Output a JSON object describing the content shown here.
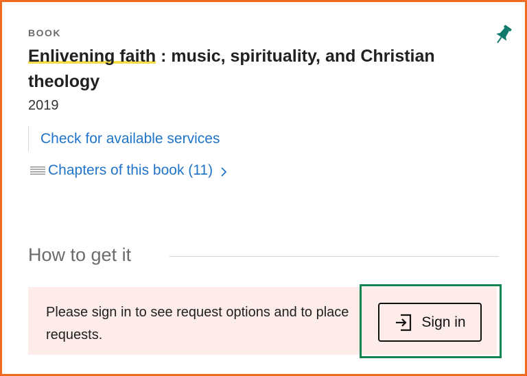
{
  "record": {
    "type_label": "BOOK",
    "title_highlight": "Enlivening faith",
    "title_rest": " : music, spirituality, and Christian theology",
    "year": "2019",
    "pin_icon": "pin-icon"
  },
  "links": {
    "services": "Check for available services",
    "chapters": "Chapters of this book (11)",
    "chapters_icon": "list-icon",
    "chevron_icon": "chevron-right-icon"
  },
  "get_it": {
    "heading": "How to get it",
    "notice": "Please sign in to see request options and to place requests.",
    "signin_label": "Sign in",
    "signin_icon": "sign-in-icon"
  },
  "colors": {
    "frame_border": "#f06a1f",
    "pin": "#0f7a6c",
    "link": "#1f74c9",
    "highlight": "#f4de4e",
    "notice_bg": "#fdecea",
    "signin_frame": "#13844f"
  }
}
